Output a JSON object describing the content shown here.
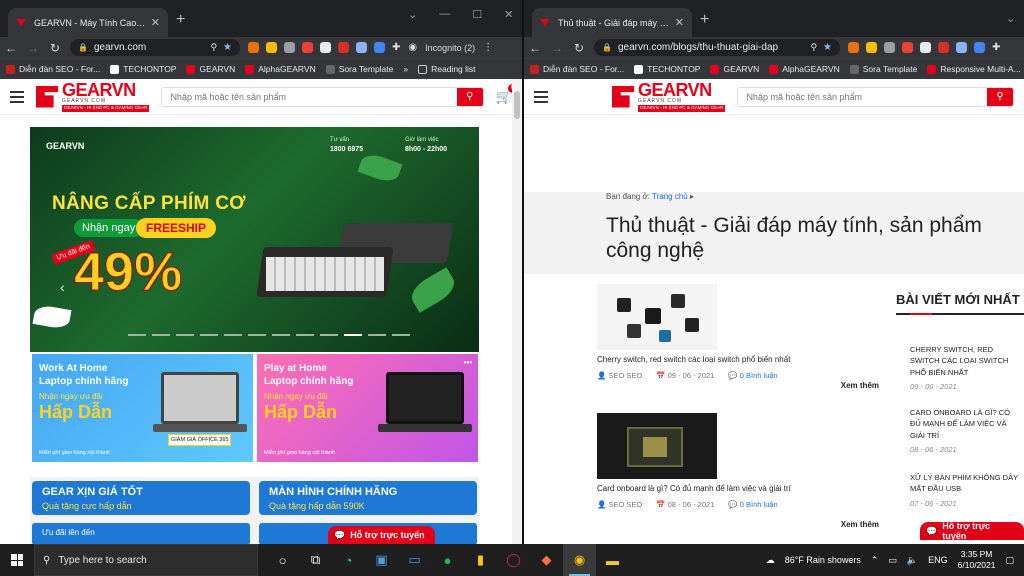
{
  "left_window": {
    "tab_title": "GEARVN - Máy Tính Cao Cấp & I",
    "url": "gearvn.com",
    "incognito": "Incognito (2)",
    "bookmarks": [
      "Diễn đàn SEO - For...",
      "TECHONTOP",
      "GEARVN",
      "AlphaGEARVN",
      "Sora Template"
    ],
    "bookmarks_more": "»",
    "reading_list": "Reading list"
  },
  "right_window": {
    "tab_title": "Thủ thuật - Giải đáp máy tính, s",
    "url": "gearvn.com/blogs/thu-thuat-giai-dap",
    "bookmarks": [
      "Diễn đàn SEO - For...",
      "TECHONTOP",
      "GEARVN",
      "AlphaGEARVN",
      "Sora Template",
      "Responsive Multi-A..."
    ]
  },
  "store": {
    "logo": "GEARVN",
    "logo_sub": "GEARVN.COM",
    "logo_tag": "GEARVN - HI END PC & GAMING GEAR",
    "search_placeholder": "Nhập mã hoặc tên sản phẩm",
    "cart_count": "0"
  },
  "banner": {
    "brand": "GEARVN",
    "hotline_label": "Tư vấn",
    "hotline": "1800 6975",
    "hours_label": "Giờ làm việc",
    "hours": "8h00 - 22h00",
    "headline": "NÂNG CẤP PHÍM CƠ",
    "pill": "Nhận ngay",
    "freeship": "FREESHIP",
    "ribbon": "Ưu đãi đến",
    "percent": "49%",
    "slide_count": 12,
    "active_slide": 9
  },
  "promos": [
    {
      "line1": "Work At Home",
      "line2": "Laptop chính hãng",
      "sub": "Nhận ngay ưu đãi",
      "big": "Hấp Dẫn",
      "note": "Miễn phí giao hàng nội thành",
      "badge": "GIẢM GIÁ OFFICE 365"
    },
    {
      "line1": "Play at Home",
      "line2": "Laptop chính hãng",
      "sub": "Nhận ngay ưu đãi",
      "big": "Hấp Dẫn",
      "note": "Miễn phí giao hàng nội thành",
      "badge": ""
    }
  ],
  "gear_boxes": [
    {
      "title": "GEAR XỊN GIÁ TỐT",
      "sub": "Quà tặng cực hấp dẫn",
      "bar": "Ưu đãi lên đến"
    },
    {
      "title": "MÀN HÌNH CHÍNH HÃNG",
      "sub": "Quà tặng hấp dẫn 590K",
      "bar": "Ưu đãi lên đến"
    }
  ],
  "support_label": "Hỗ trợ trực tuyến",
  "blog": {
    "breadcrumb_prefix": "Bạn đang ở:",
    "breadcrumb_link": "Trang chủ",
    "title": "Thủ thuật - Giải đáp máy tính, sản phẩm công nghệ",
    "posts": [
      {
        "title": "Cherry switch, red switch các loại switch phổ biến nhất",
        "author": "SEO SEO",
        "date": "09 - 06 - 2021",
        "comments": "0 Bình luận",
        "more": "Xem thêm"
      },
      {
        "title": "Card onboard là gì? Có đủ mạnh để làm việc và giải trí",
        "author": "SEO SEO",
        "date": "08 - 06 - 2021",
        "comments": "0 Bình luận",
        "more": "Xem thêm"
      }
    ],
    "sidebar_title": "BÀI VIẾT MỚI NHẤT",
    "sidebar_items": [
      {
        "title": "CHERRY SWITCH, RED SWITCH CÁC LOẠI SWITCH PHỔ BIẾN NHẤT",
        "date": "09 - 06 - 2021"
      },
      {
        "title": "CARD ONBOARD LÀ GÌ? CÓ ĐỦ MẠNH ĐỂ LÀM VIỆC VÀ GIẢI TRÍ",
        "date": "08 - 06 - 2021"
      },
      {
        "title": "XỬ LÝ BÀN PHÍM KHÔNG DÂY MẤT ĐẦU USB",
        "date": "07 - 06 - 2021"
      }
    ]
  },
  "taskbar": {
    "search_placeholder": "Type here to search",
    "weather": "86°F  Rain showers",
    "language": "ENG",
    "time": "3:35 PM",
    "date": "6/10/2021"
  }
}
